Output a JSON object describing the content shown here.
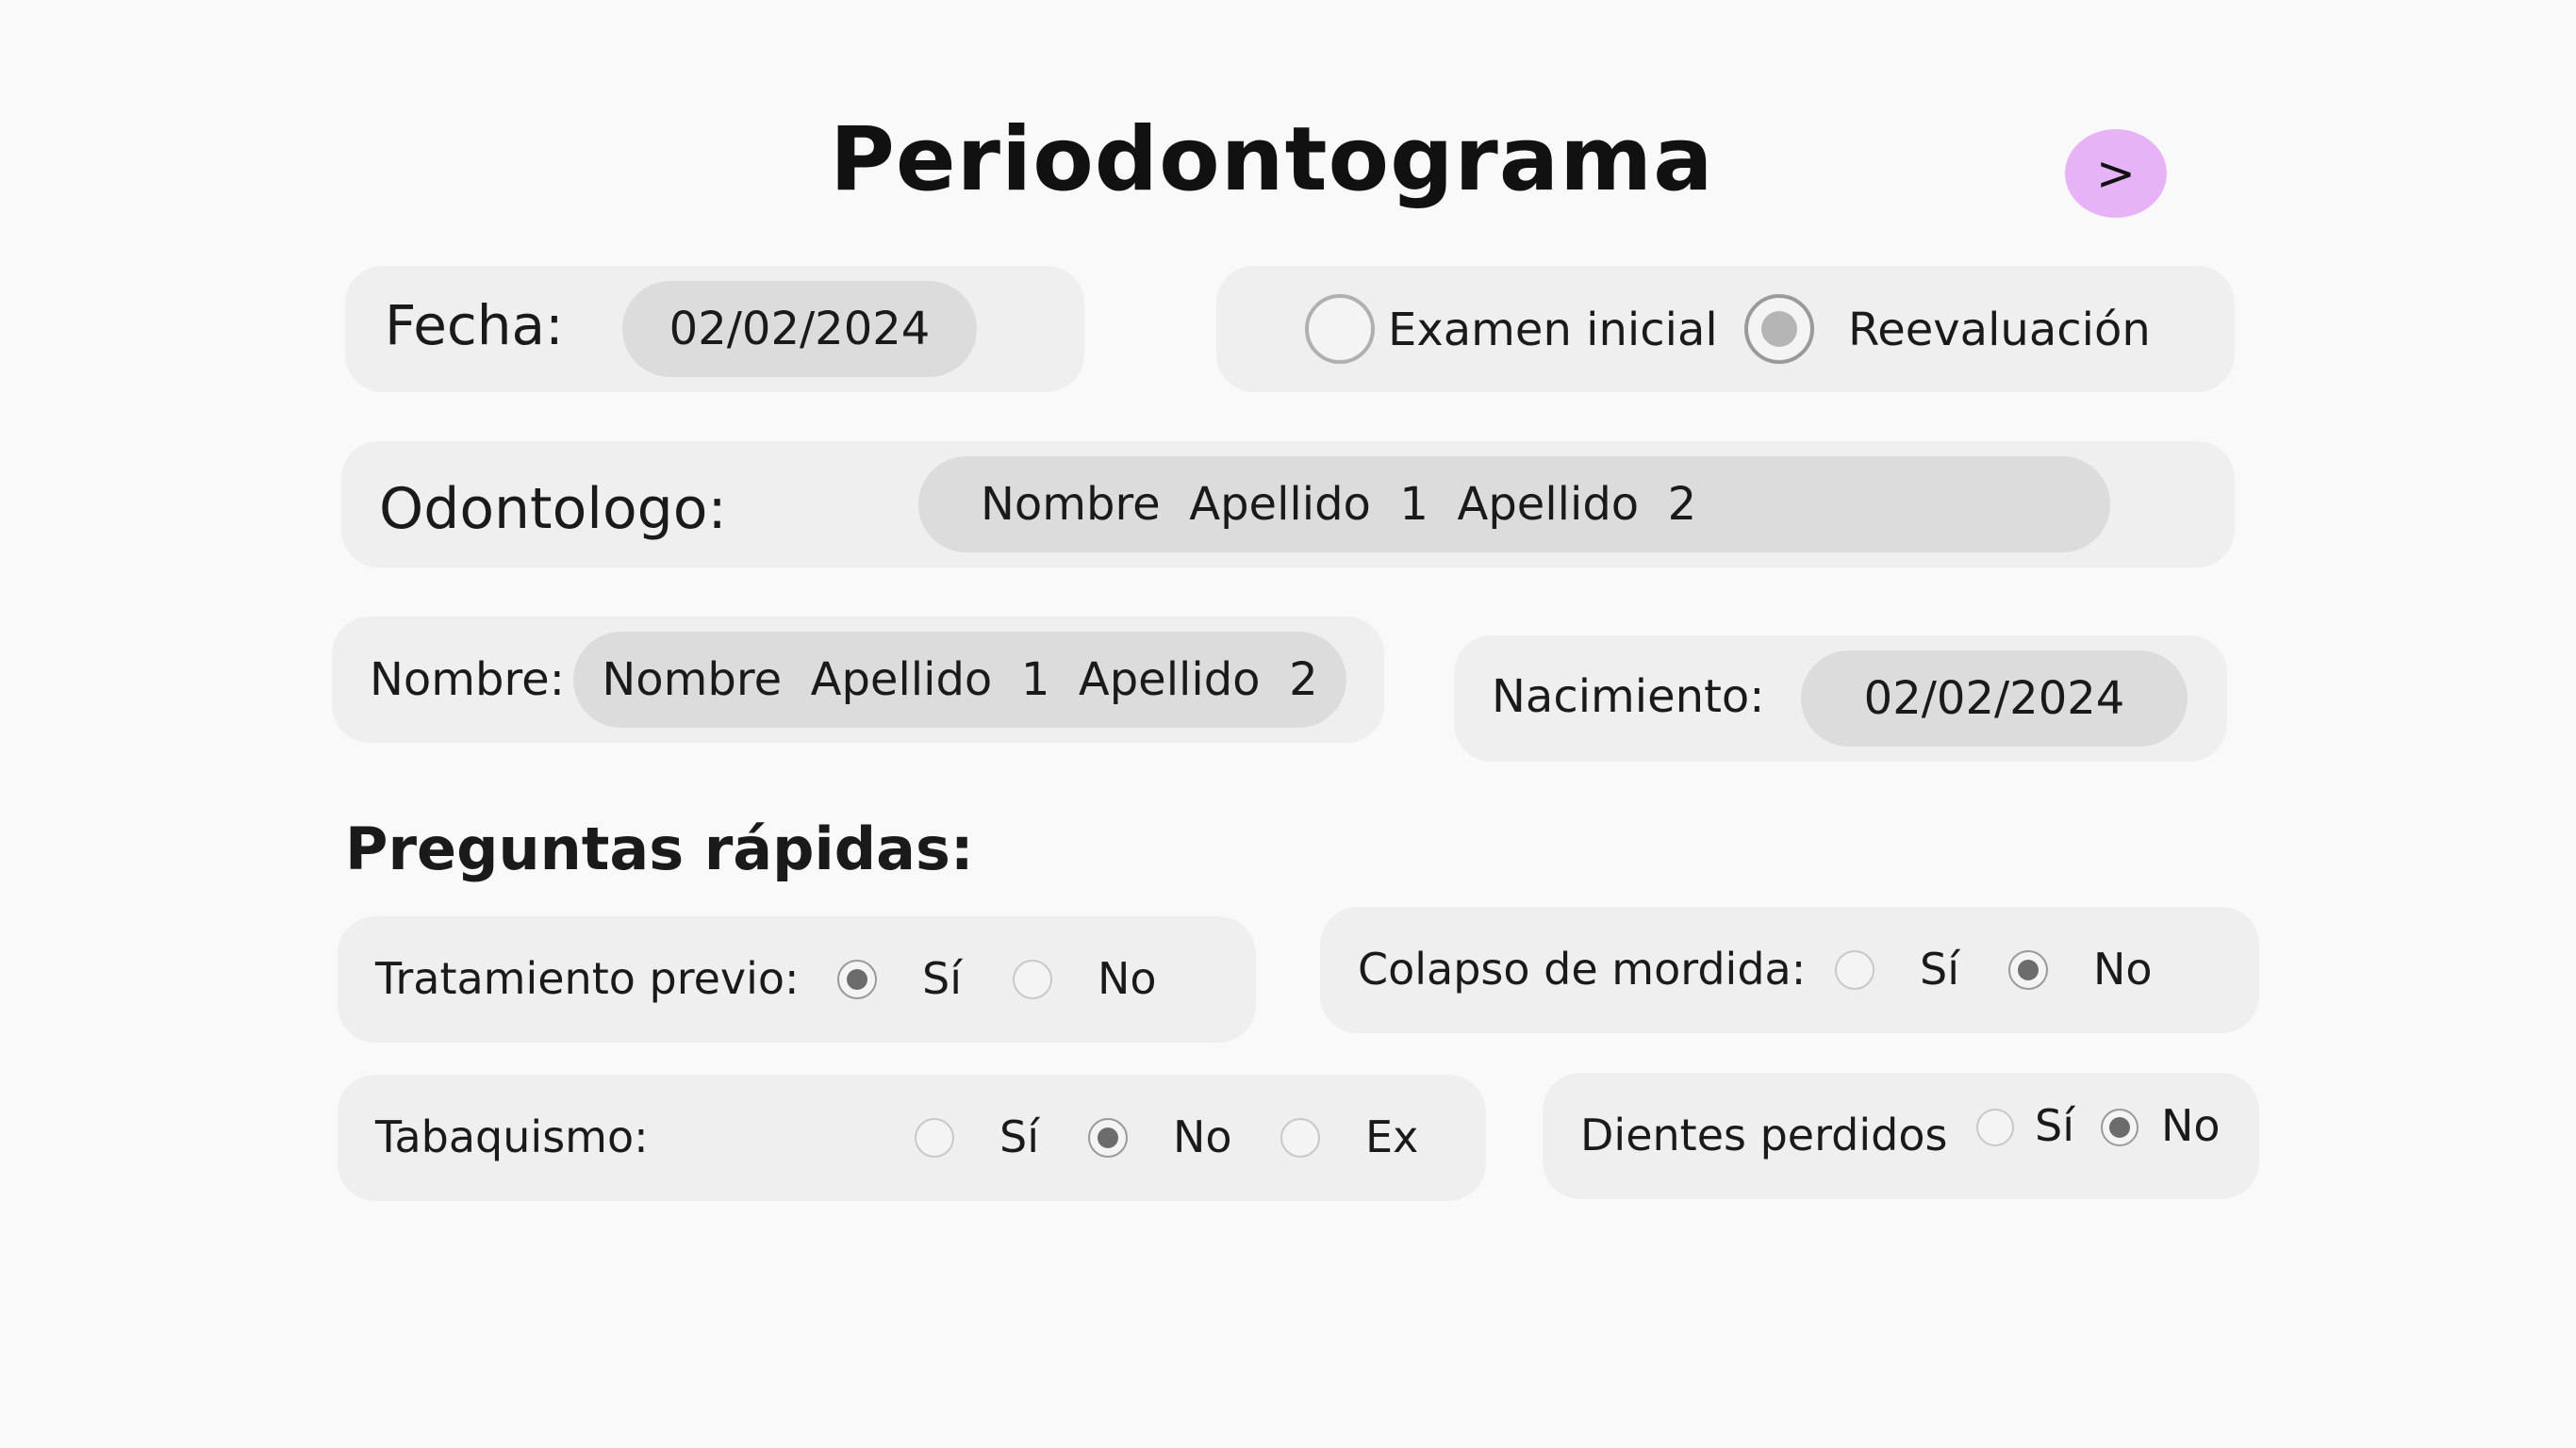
{
  "header": {
    "title": "Periodontograma",
    "next_label": ">"
  },
  "fecha": {
    "label": "Fecha:",
    "value": "02/02/2024"
  },
  "exam_type": {
    "options": [
      {
        "label": "Examen inicial",
        "selected": false
      },
      {
        "label": "Reevaluación",
        "selected": true
      }
    ]
  },
  "odontologo": {
    "label": "Odontologo:",
    "value": "Nombre  Apellido  1  Apellido  2"
  },
  "paciente": {
    "nombre_label": "Nombre:",
    "nombre_value": "Nombre  Apellido  1  Apellido  2",
    "nacimiento_label": "Nacimiento:",
    "nacimiento_value": "02/02/2024"
  },
  "quick_questions": {
    "heading": "Preguntas rápidas:",
    "tratamiento": {
      "label": "Tratamiento previo:",
      "options": [
        "Sí",
        "No"
      ],
      "selected": "Sí"
    },
    "colapso": {
      "label": "Colapso de mordida:",
      "options": [
        "Sí",
        "No"
      ],
      "selected": "No"
    },
    "tabaquismo": {
      "label": "Tabaquismo:",
      "options": [
        "Sí",
        "No",
        "Ex"
      ],
      "selected": "No"
    },
    "dientes": {
      "label": "Dientes perdidos",
      "options": [
        "Sí",
        "No"
      ],
      "selected": "No"
    }
  }
}
